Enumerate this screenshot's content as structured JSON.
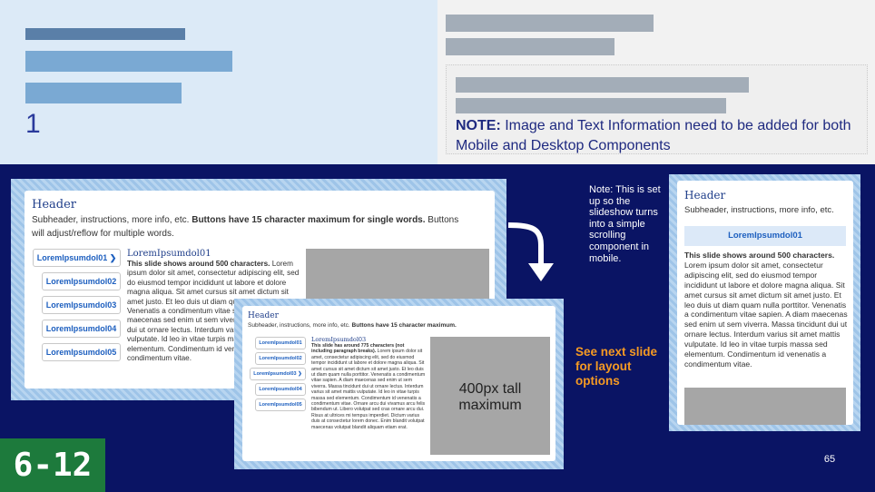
{
  "colors": {
    "background": "#0a1464",
    "note_text": "#1f2a80",
    "orange": "#f59a23",
    "grade_bg": "#1d7a3c",
    "link_blue": "#1d5fbf"
  },
  "top_left": {
    "slide_index": "1"
  },
  "top_right": {
    "note_label": "NOTE:",
    "note_text": "Image and Text Information need to be added for both Mobile and Desktop Components"
  },
  "desktop_card": {
    "header": "Header",
    "subheader": "Subheader, instructions, more info, etc. ",
    "subheader_bold": "Buttons have 15 character maximum for single words.",
    "subheader_tail": " Buttons will adjust/reflow for multiple words.",
    "buttons": [
      "LoremIpsumdol01",
      "LoremIpsumdol02",
      "LoremIpsumdol03",
      "LoremIpsumdol04",
      "LoremIpsumdol05"
    ],
    "content_title": "LoremIpsumdol01",
    "content_bold": "This slide shows around 500 characters.",
    "content_text": " Lorem ipsum dolor sit amet, consectetur adipiscing elit, sed do eiusmod tempor incididunt ut labore et dolore magna aliqua. Sit amet cursus sit amet dictum sit amet justo. Et leo duis ut diam quam nulla porttitor. Venenatis a condimentum vitae sapien. A diam maecenas sed enim ut sem viverra. Massa tincidunt dui ut ornare lectus. Interdum varius sit amet mattis vulputate. Id leo in vitae turpis massa sed elementum. Condimentum id venenatis a condimentum vitae."
  },
  "tablet_card": {
    "header": "Header",
    "subheader": "Subheader, instructions, more info, etc. ",
    "subheader_bold": "Buttons have 15 character maximum.",
    "buttons": [
      "LoremIpsumdol01",
      "LoremIpsumdol02",
      "LoremIpsumdol03",
      "LoremIpsumdol04",
      "LoremIpsumdol05"
    ],
    "content_title": "LoremIpsumdol03",
    "content_bold": "This slide has around 775 characters (not including paragraph breaks).",
    "content_text": " Lorem ipsum dolor sit amet, consectetur adipiscing elit, sed do eiusmod tempor incididunt ut labore et dolore magna aliqua. Sit amet cursus sit amet dictum sit amet justo. Et leo duis ut diam quam nulla porttitor. Venenatis a condimentum vitae sapien. A diam maecenas sed enim ut sem viverra. Massa tincidunt dui ut ornare lectus. Interdum varius sit amet mattis vulputate. Id leo in vitae turpis massa sed elementum. Condimentum id venenatis a condimentum vitae. Ornare arcu dui vivamus arcu felis bibendum ut. Libero volutpat sed cras ornare arcu dui. Risus at ultrices mi tempus imperdiet. Dictum varius duis at consectetur lorem donec. Enim blandit volutpat maecenas volutpat blandit aliquam etiam erat.",
    "image_label": "400px tall maximum"
  },
  "mobile_card": {
    "header": "Header",
    "subheader": "Subheader, instructions, more info, etc.",
    "button": "LoremIpsumdol01",
    "content_bold": "This slide shows around 500 characters.",
    "content_text": "Lorem ipsum dolor sit amet, consectetur adipiscing elit, sed do eiusmod tempor incididunt ut labore et dolore magna aliqua. Sit amet cursus sit amet dictum sit amet justo. Et leo duis ut diam quam nulla porttitor. Venenatis a condimentum vitae sapien. A diam maecenas sed enim ut sem viverra. Massa tincidunt dui ut ornare lectus. Interdum varius sit amet mattis vulputate. Id leo in vitae turpis massa sed elementum. Condimentum id venenatis a condimentum vitae."
  },
  "side_note": "Note: This is set up so the slideshow turns into a simple scrolling component in mobile.",
  "see_next": "See next slide for layout options",
  "grade_badge": "6-12",
  "page_number": "65"
}
